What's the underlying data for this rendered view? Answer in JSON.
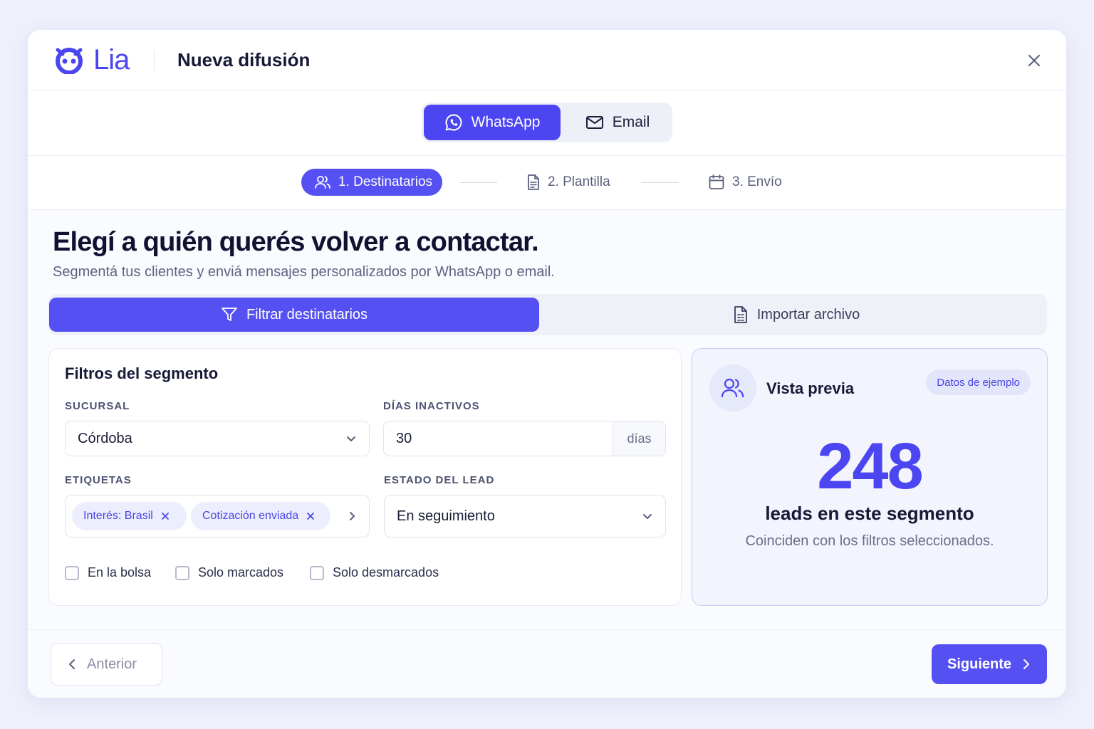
{
  "brand": {
    "name": "Lia",
    "accent": "#4b46f1"
  },
  "header": {
    "title": "Nueva difusión",
    "close_icon": "close-icon"
  },
  "channels": [
    {
      "label": "WhatsApp",
      "icon": "whatsapp-icon",
      "active": true
    },
    {
      "label": "Email",
      "icon": "mail-icon",
      "active": false
    }
  ],
  "steps": [
    {
      "label": "1. Destinatarios",
      "icon": "users-icon",
      "active": true
    },
    {
      "label": "2. Plantilla",
      "icon": "document-icon",
      "active": false
    },
    {
      "label": "3. Envío",
      "icon": "calendar-icon",
      "active": false
    }
  ],
  "main": {
    "heading": "Elegí a quién querés volver a contactar.",
    "subheading": "Segmentá tus clientes y enviá mensajes personalizados por WhatsApp o email."
  },
  "modes": [
    {
      "label": "Filtrar destinatarios",
      "icon": "filter-icon",
      "active": true
    },
    {
      "label": "Importar archivo",
      "icon": "file-icon",
      "active": false
    }
  ],
  "filters": {
    "title": "Filtros del segmento",
    "branch": {
      "label": "SUCURSAL",
      "value": "Córdoba"
    },
    "inactive_days": {
      "label": "DÍAS INACTIVOS",
      "value": "30",
      "suffix": "días"
    },
    "tags": {
      "label": "ETIQUETAS",
      "items": [
        "Interés: Brasil",
        "Cotización enviada"
      ]
    },
    "lead_state": {
      "label": "ESTADO DEL LEAD",
      "value": "En seguimiento"
    },
    "checkboxes": [
      {
        "label": "En la bolsa",
        "checked": false
      },
      {
        "label": "Solo marcados",
        "checked": false
      },
      {
        "label": "Solo desmarcados",
        "checked": false
      }
    ]
  },
  "preview": {
    "title": "Vista previa",
    "badge": "Datos de ejemplo",
    "count": "248",
    "count_label": "leads en este segmento",
    "count_sub": "Coinciden con los filtros seleccionados."
  },
  "footer": {
    "prev_label": "Anterior",
    "next_label": "Siguiente"
  }
}
